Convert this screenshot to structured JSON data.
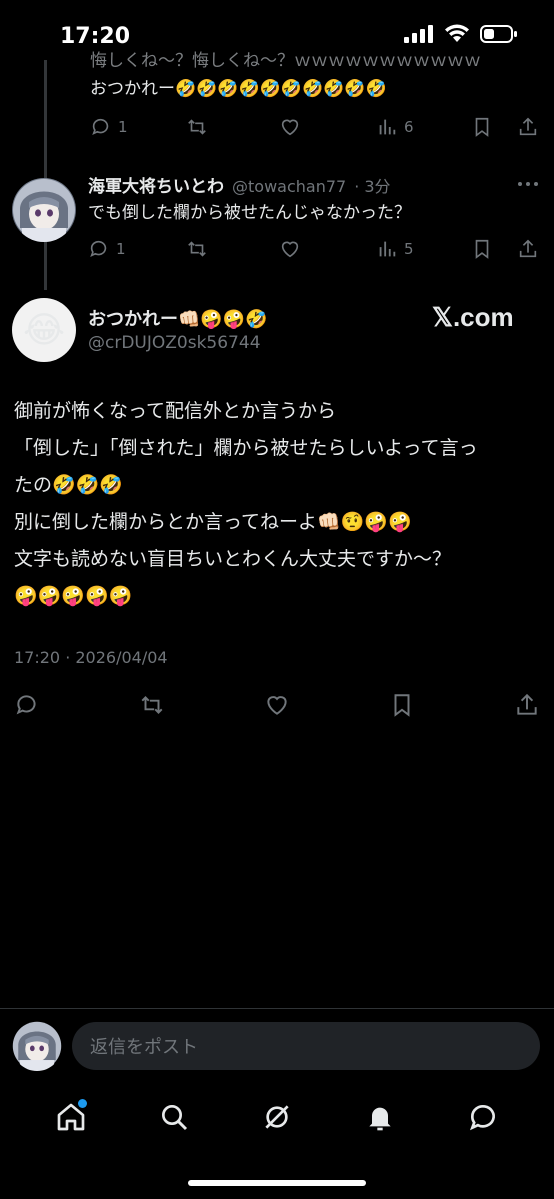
{
  "status_bar": {
    "time": "17:20"
  },
  "thread": {
    "prev_tweet": {
      "partial_top_text": "悔しくね〜？悔しくね〜？ｗｗｗｗｗｗｗｗｗｗｗ",
      "text": "おつかれー🤣🤣🤣🤣🤣🤣🤣🤣🤣🤣",
      "replies": "1",
      "views": "6"
    },
    "reply_tweet": {
      "name": "海軍大将ちいとわ",
      "handle": "@towachan77",
      "time": "· 3分",
      "text": "でも倒した欄から被せたんじゃなかった？",
      "replies": "1",
      "views": "5"
    }
  },
  "main_tweet": {
    "avatar_emoji": "😂",
    "name": "おつかれー👊🏻🤪🤪🤣",
    "handle": "@crDUJOZ0sk56744",
    "watermark": "𝕏.com",
    "lines": [
      "御前が怖くなって配信外とか言うから",
      "「倒した」「倒された」欄から被せたらしいよって言っ",
      "たの🤣🤣🤣",
      "別に倒した欄からとか言ってねーよ👊🏻🤨🤪🤪",
      "文字も読めない盲目ちいとわくん大丈夫ですか〜？",
      "🤪🤪🤪🤪🤪"
    ],
    "timestamp": "17:20 · 2026/04/04"
  },
  "reply_composer": {
    "placeholder": "返信をポスト"
  },
  "nav": {
    "items": [
      "home-icon",
      "search-icon",
      "grok-icon",
      "notifications-icon",
      "messages-icon"
    ]
  },
  "colors": {
    "accent": "#1d9bf0",
    "muted": "#71767b",
    "text": "#e7e9ea",
    "background": "#000000"
  }
}
